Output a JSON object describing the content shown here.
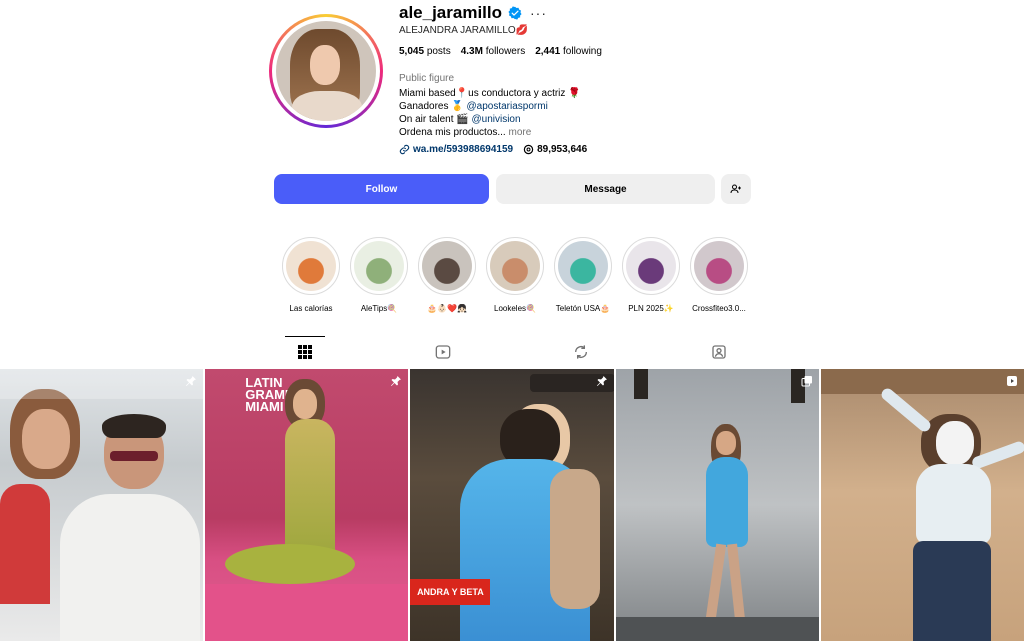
{
  "profile": {
    "username": "ale_jaramillo",
    "more_symbol": "···",
    "full_name": "ALEJANDRA JARAMILLO💋",
    "stats": [
      {
        "value": "5,045",
        "label": "posts"
      },
      {
        "value": "4.3M",
        "label": "followers"
      },
      {
        "value": "2,441",
        "label": "following"
      }
    ],
    "category": "Public figure",
    "bio": {
      "line1": "Miami based📍us conductora y actriz 🌹",
      "line2_text": "Ganadores 🥇 ",
      "line2_link": "@apostariaspormi",
      "line3_text": "On air talent 🎬 ",
      "line3_link": "@univision",
      "line4_text": "Ordena mis productos... ",
      "line4_more": "more"
    },
    "website": "wa.me/593988694159",
    "threads_count": "89,953,646"
  },
  "actions": {
    "follow_label": "Follow",
    "message_label": "Message"
  },
  "highlights": [
    {
      "label": "Las calorías",
      "color_a": "#f0e2d3",
      "color_b": "#e07a3a"
    },
    {
      "label": "AleTips🍭",
      "color_a": "#e9efe3",
      "color_b": "#8fb07a"
    },
    {
      "label": "🎂👶🏻❤️👧🏻",
      "color_a": "#c9c3bd",
      "color_b": "#5a4a42"
    },
    {
      "label": "Lookeles🍭",
      "color_a": "#d8cbbb",
      "color_b": "#c98d6b"
    },
    {
      "label": "Teletón USA🎂",
      "color_a": "#c8d3db",
      "color_b": "#3bb6a0"
    },
    {
      "label": "PLN 2025✨",
      "color_a": "#e9e5ea",
      "color_b": "#6a3a7a"
    },
    {
      "label": "Crossfiteo3.0...",
      "color_a": "#d1c8cc",
      "color_b": "#b84d84"
    }
  ],
  "tabs": [
    {
      "name": "tab-posts",
      "icon": "grid-icon"
    },
    {
      "name": "tab-reels",
      "icon": "reels-icon"
    },
    {
      "name": "tab-reposts",
      "icon": "repost-icon"
    },
    {
      "name": "tab-tagged",
      "icon": "tagged-icon"
    }
  ],
  "posts": [
    {
      "badge": "pin-icon",
      "overlay_text": ""
    },
    {
      "badge": "pin-icon",
      "overlay_text": "LATIN GRAMMY MIAMI"
    },
    {
      "badge": "pin-icon",
      "overlay_text": "ANDRA Y BETA"
    },
    {
      "badge": "carousel-icon",
      "overlay_text": ""
    },
    {
      "badge": "reel-icon",
      "overlay_text": ""
    }
  ],
  "colors": {
    "follow_button": "#4a5df9",
    "link": "#00376b",
    "verified": "#0095f6"
  }
}
